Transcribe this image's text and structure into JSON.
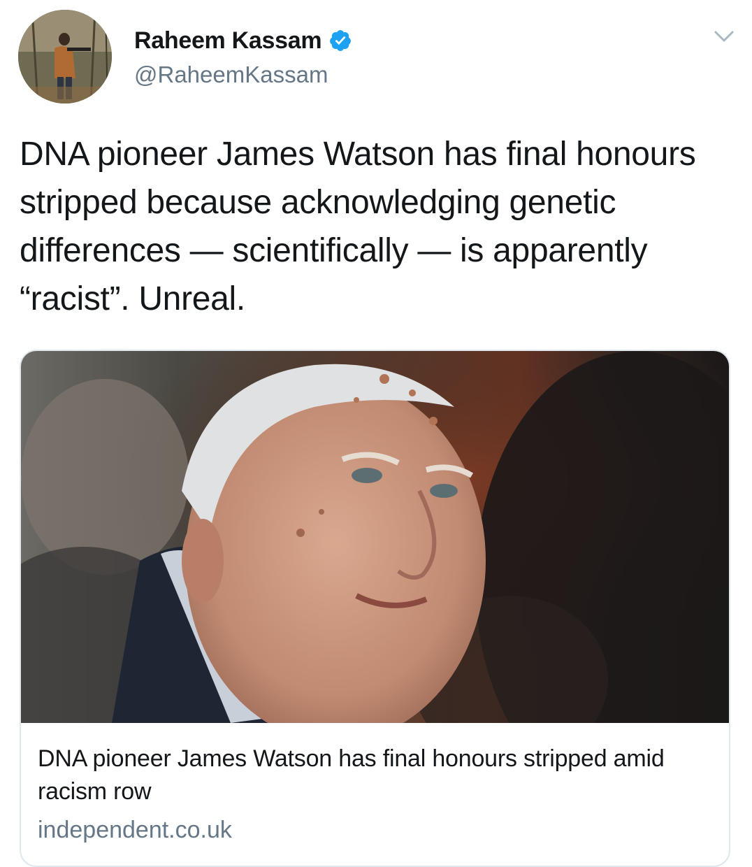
{
  "author": {
    "display_name": "Raheem Kassam",
    "handle": "@RaheemKassam",
    "verified": true,
    "avatar_icon": "avatar-photo-icon"
  },
  "tweet": {
    "text": "DNA pioneer James Watson has final honours stripped because acknowledging genetic differences — scientifically — is apparently “racist”. Unreal."
  },
  "card": {
    "image_icon": "article-photo-icon",
    "title": "DNA pioneer James Watson has final honours stripped amid racism row",
    "domain": "independent.co.uk"
  },
  "colors": {
    "text": "#14171a",
    "secondary": "#657786",
    "verified": "#1da1f2",
    "border": "#e1e8ed"
  }
}
